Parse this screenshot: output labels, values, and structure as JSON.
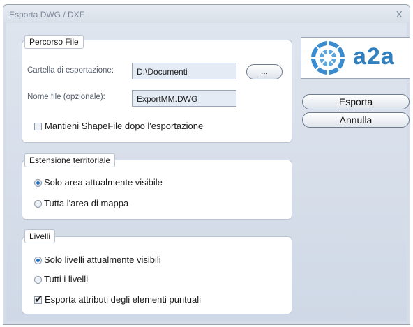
{
  "window": {
    "title": "Esporta DWG / DXF",
    "close_glyph": "x"
  },
  "file_group": {
    "legend": "Percorso File",
    "folder_label": "Cartella di esportazione:",
    "folder_value": "D:\\Documenti",
    "browse_label": "...",
    "filename_label": "Nome file (opzionale):",
    "filename_value": "ExportMM.DWG",
    "keep_shapefile_label": "Mantieni ShapeFile dopo l'esportazione",
    "keep_shapefile_checked": false
  },
  "territory_group": {
    "legend": "Estensione territoriale",
    "options": [
      {
        "label": "Solo area attualmente visibile",
        "selected": true
      },
      {
        "label": "Tutta l'area di mappa",
        "selected": false
      }
    ]
  },
  "levels_group": {
    "legend": "Livelli",
    "options": [
      {
        "label": "Solo livelli attualmente visibili",
        "selected": true
      },
      {
        "label": "Tutti i livelli",
        "selected": false
      }
    ],
    "export_attributes_label": "Esporta attributi degli elementi puntuali",
    "export_attributes_checked": true
  },
  "logo": {
    "text": "a2a",
    "brand_color": "#2f7fbf"
  },
  "buttons": {
    "export_label": "Esporta",
    "cancel_label": "Annulla"
  }
}
